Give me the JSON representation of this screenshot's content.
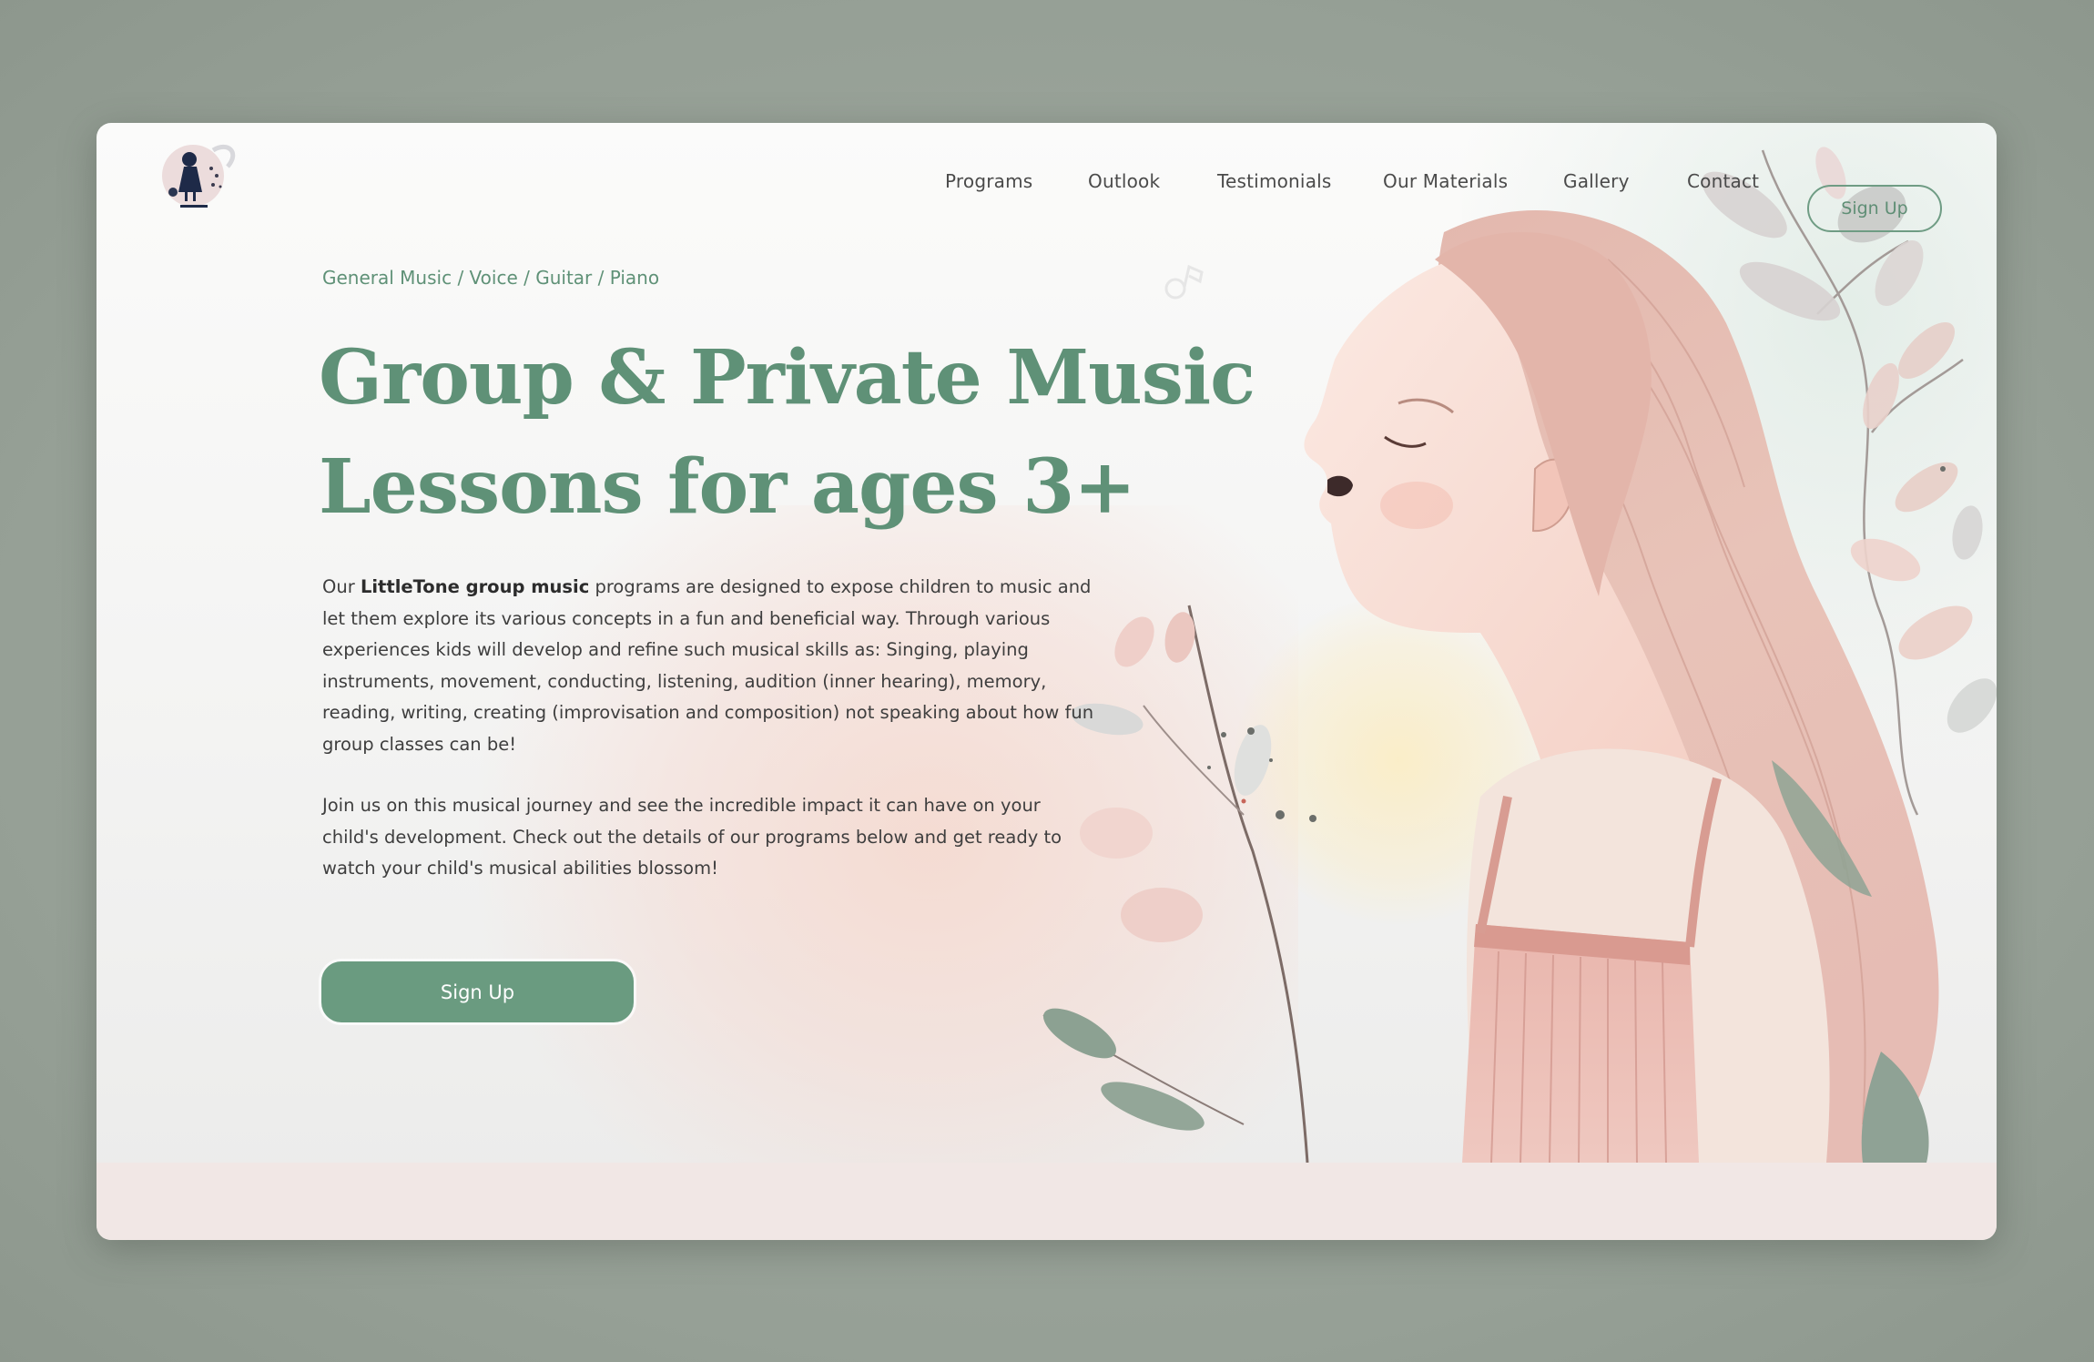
{
  "brand": {
    "name": "LittleTone",
    "logo_icon": "girl-silhouette-logo-icon"
  },
  "nav": {
    "items": [
      {
        "label": "Programs"
      },
      {
        "label": "Outlook"
      },
      {
        "label": "Testimonials"
      },
      {
        "label": "Our Materials"
      },
      {
        "label": "Gallery"
      },
      {
        "label": "Contact"
      }
    ],
    "signup_label": "Sign Up"
  },
  "hero": {
    "subtitle": "General Music / Voice / Guitar / Piano",
    "headline_line1": "Group & Private Music",
    "headline_line2": "Lessons for ages 3+",
    "paragraph1": {
      "prefix": "Our ",
      "bold": "LittleTone group music",
      "rest": " programs are designed to expose children to music and let them explore its various concepts in a fun and beneficial way. Through various experiences kids will develop and refine such musical skills as: Singing, playing instruments, movement, conducting, listening, audition (inner hearing), memory, reading, writing, creating (improvisation and composition) not speaking about how fun group classes can be!"
    },
    "paragraph2": "Join us on this musical journey and see the incredible impact it can have on your child's development. Check out the details of our programs below and get ready to watch your child's musical abilities blossom!",
    "cta_label": "Sign Up",
    "illustration": "watercolor-girl-singing-with-leaves",
    "decor_icon": "music-note-icon"
  },
  "colors": {
    "accent_green": "#6a9b80",
    "heading_green": "#5f9177",
    "body_text": "#3e3e3e",
    "footer_strip": "#f1e7e5",
    "outer_bg": "#9ba39a"
  }
}
